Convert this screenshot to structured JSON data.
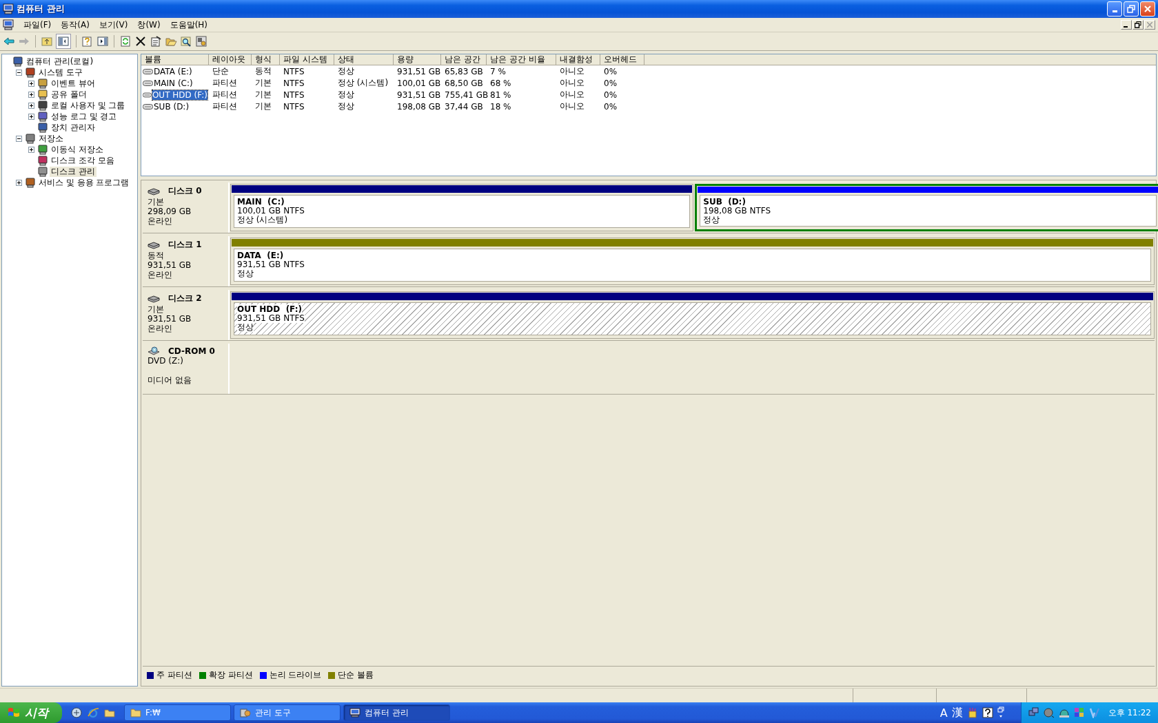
{
  "window": {
    "title": "컴퓨터 관리"
  },
  "menu": [
    "파일(F)",
    "동작(A)",
    "보기(V)",
    "창(W)",
    "도움말(H)"
  ],
  "tree": [
    {
      "label": "컴퓨터 관리(로컬)",
      "selected": false,
      "children": [
        {
          "label": "시스템 도구",
          "expanded": true,
          "selected": false,
          "children": [
            {
              "label": "이벤트 뷰어",
              "expanded": false,
              "selected": false
            },
            {
              "label": "공유 폴더",
              "expanded": false,
              "selected": false
            },
            {
              "label": "로컬 사용자 및 그룹",
              "expanded": false,
              "selected": false
            },
            {
              "label": "성능 로그 및 경고",
              "expanded": false,
              "selected": false
            },
            {
              "label": "장치 관리자",
              "selected": false
            }
          ]
        },
        {
          "label": "저장소",
          "expanded": true,
          "selected": false,
          "children": [
            {
              "label": "이동식 저장소",
              "expanded": false,
              "selected": false
            },
            {
              "label": "디스크 조각 모음",
              "selected": false
            },
            {
              "label": "디스크 관리",
              "selected": true
            }
          ]
        },
        {
          "label": "서비스 및 응용 프로그램",
          "expanded": false,
          "selected": false
        }
      ]
    }
  ],
  "table": {
    "columns": [
      "볼륨",
      "레이아웃",
      "형식",
      "파일 시스템",
      "상태",
      "용량",
      "남은 공간",
      "남은 공간 비율",
      "내결함성",
      "오버헤드"
    ],
    "rows": [
      {
        "selected": false,
        "cells": [
          "DATA (E:)",
          "단순",
          "동적",
          "NTFS",
          "정상",
          "931,51 GB",
          "65,83 GB",
          "7 %",
          "아니오",
          "0%"
        ]
      },
      {
        "selected": false,
        "cells": [
          "MAIN (C:)",
          "파티션",
          "기본",
          "NTFS",
          "정상 (시스템)",
          "100,01 GB",
          "68,50 GB",
          "68 %",
          "아니오",
          "0%"
        ]
      },
      {
        "selected": true,
        "cells": [
          "OUT HDD (F:)",
          "파티션",
          "기본",
          "NTFS",
          "정상",
          "931,51 GB",
          "755,41 GB",
          "81 %",
          "아니오",
          "0%"
        ]
      },
      {
        "selected": false,
        "cells": [
          "SUB (D:)",
          "파티션",
          "기본",
          "NTFS",
          "정상",
          "198,08 GB",
          "37,44 GB",
          "18 %",
          "아니오",
          "0%"
        ]
      }
    ]
  },
  "disks": [
    {
      "kind": "disk",
      "name": "디스크 0",
      "type": "기본",
      "size": "298,09 GB",
      "status": "온라인",
      "partitions": [
        {
          "kind": "primary",
          "color": "#000080",
          "selected": false,
          "name": "MAIN  (C:)",
          "size": "100,01 GB NTFS",
          "status": "정상 (시스템)"
        },
        {
          "kind": "logical",
          "color": "#0000ff",
          "selected": false,
          "name": "SUB  (D:)",
          "size": "198,08 GB NTFS",
          "status": "정상"
        }
      ]
    },
    {
      "kind": "disk",
      "name": "디스크 1",
      "type": "동적",
      "size": "931,51 GB",
      "status": "온라인",
      "partitions": [
        {
          "kind": "primary",
          "color": "#808000",
          "selected": false,
          "name": "DATA  (E:)",
          "size": "931,51 GB NTFS",
          "status": "정상"
        }
      ]
    },
    {
      "kind": "disk",
      "name": "디스크 2",
      "type": "기본",
      "size": "931,51 GB",
      "status": "온라인",
      "partitions": [
        {
          "kind": "primary",
          "color": "#000080",
          "selected": true,
          "name": "OUT HDD  (F:)",
          "size": "931,51 GB NTFS",
          "status": "정상"
        }
      ]
    },
    {
      "kind": "cdrom",
      "name": "CD-ROM 0",
      "type": "DVD (Z:)",
      "status": "미디어 없음"
    }
  ],
  "legend": [
    {
      "label": "주 파티션",
      "color": "#000080"
    },
    {
      "label": "확장 파티션",
      "color": "#008000"
    },
    {
      "label": "논리 드라이브",
      "color": "#0000ff"
    },
    {
      "label": "단순 볼륨",
      "color": "#808000"
    }
  ],
  "taskbar": {
    "start": "시작",
    "tasks": [
      {
        "label": "F:₩",
        "selected": false
      },
      {
        "label": "관리 도구",
        "selected": false
      },
      {
        "label": "컴퓨터 관리",
        "selected": true
      }
    ],
    "ime": [
      "A",
      "漢"
    ],
    "clock": "오후 11:22"
  }
}
